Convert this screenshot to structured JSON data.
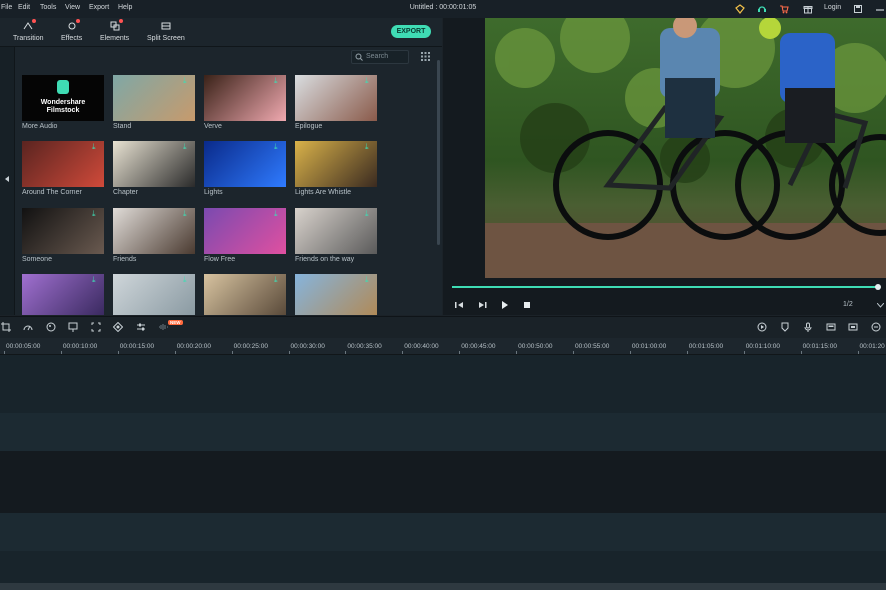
{
  "menu": [
    "File",
    "Edit",
    "Tools",
    "View",
    "Export",
    "Help"
  ],
  "title": "Untitled : 00:00:01:05",
  "header_right": {
    "login": "Login"
  },
  "toolbar": {
    "items": [
      {
        "label": "Transition",
        "icon": "transition-icon",
        "badge": true
      },
      {
        "label": "Effects",
        "icon": "effects-icon",
        "badge": true
      },
      {
        "label": "Elements",
        "icon": "elements-icon",
        "badge": true
      },
      {
        "label": "Split Screen",
        "icon": "split-screen-icon",
        "badge": false
      }
    ],
    "export_label": "EXPORT"
  },
  "search": {
    "placeholder": "Search"
  },
  "library": {
    "brand_line1": "Wondershare",
    "brand_line2": "Filmstock",
    "items": [
      {
        "label": "More Audio",
        "colors": [
          "#000",
          "#000"
        ]
      },
      {
        "label": "Stand",
        "colors": [
          "#7fa8a6",
          "#c79a6c"
        ]
      },
      {
        "label": "Verve",
        "colors": [
          "#3a2218",
          "#f0a9b0"
        ]
      },
      {
        "label": "Epilogue",
        "colors": [
          "#d9dde0",
          "#8a5a4a"
        ]
      },
      {
        "label": "Around The Corner",
        "colors": [
          "#5a2420",
          "#d04a3a"
        ]
      },
      {
        "label": "Chapter",
        "colors": [
          "#e8e2d2",
          "#2a2a2a"
        ]
      },
      {
        "label": "Lights",
        "colors": [
          "#0a2a8a",
          "#2f7bff"
        ]
      },
      {
        "label": "Lights Are Whistle",
        "colors": [
          "#d9b24a",
          "#3a2a20"
        ]
      },
      {
        "label": "Someone",
        "colors": [
          "#111",
          "#6a5a50"
        ]
      },
      {
        "label": "Friends",
        "colors": [
          "#e0dcd8",
          "#4a3a30"
        ]
      },
      {
        "label": "Flow Free",
        "colors": [
          "#7a4ab0",
          "#e050a0"
        ]
      },
      {
        "label": "Friends on the way",
        "colors": [
          "#d8d2cc",
          "#5a5a5a"
        ]
      },
      {
        "label": "",
        "colors": [
          "#a070d0",
          "#3a2a60"
        ]
      },
      {
        "label": "",
        "colors": [
          "#cfd6da",
          "#8a9aa2"
        ]
      },
      {
        "label": "",
        "colors": [
          "#d7c3a0",
          "#5a4a3a"
        ]
      },
      {
        "label": "",
        "colors": [
          "#86b4dc",
          "#b08a58"
        ]
      }
    ]
  },
  "player": {
    "page": "1/2",
    "progress": 1.0
  },
  "timeline": {
    "ticks": [
      "00:00:05:00",
      "00:00:10:00",
      "00:00:15:00",
      "00:00:20:00",
      "00:00:25:00",
      "00:00:30:00",
      "00:00:35:00",
      "00:00:40:00",
      "00:00:45:00",
      "00:00:50:00",
      "00:00:55:00",
      "00:01:00:00",
      "00:01:05:00",
      "00:01:10:00",
      "00:01:15:00",
      "00:01:20"
    ],
    "new_badge": "NEW"
  },
  "colors": {
    "accent": "#3fdcb4",
    "badge": "#ff5353"
  }
}
